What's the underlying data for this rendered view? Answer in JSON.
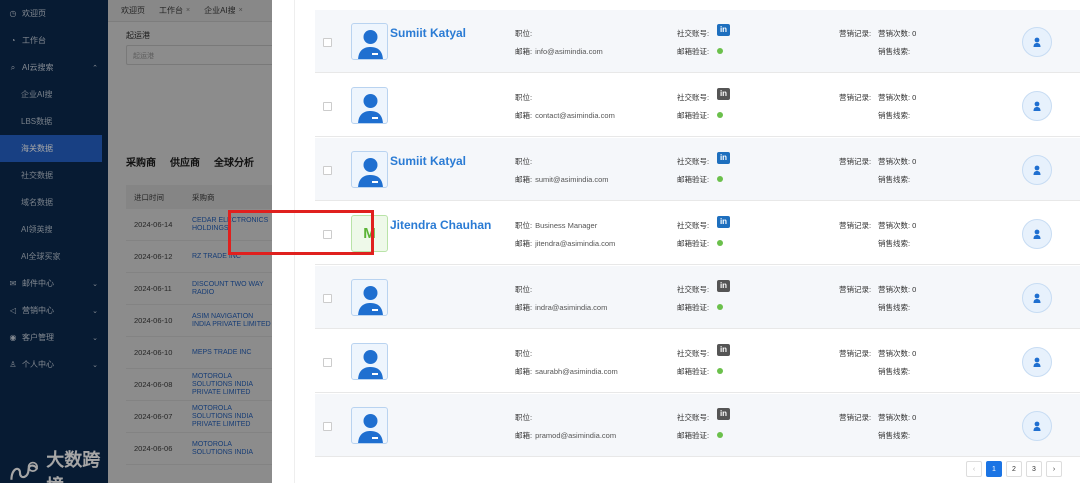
{
  "sidebar": {
    "items": [
      {
        "label": "欢迎页",
        "icon": "home-icon"
      },
      {
        "label": "工作台",
        "icon": "clock-icon"
      },
      {
        "label": "AI云搜索",
        "icon": "search-icon"
      },
      {
        "label": "企业AI搜"
      },
      {
        "label": "LBS数据"
      },
      {
        "label": "海关数据"
      },
      {
        "label": "社交数据"
      },
      {
        "label": "域名数据"
      },
      {
        "label": "AI领英搜"
      },
      {
        "label": "AI全球买家"
      },
      {
        "label": "邮件中心",
        "icon": "mail-icon"
      },
      {
        "label": "营销中心",
        "icon": "megaphone-icon"
      },
      {
        "label": "客户管理",
        "icon": "users-icon"
      },
      {
        "label": "个人中心",
        "icon": "person-icon"
      }
    ],
    "brand": "大数跨境"
  },
  "middle": {
    "tabs": [
      {
        "label": "欢迎页"
      },
      {
        "label": "工作台",
        "close": "×"
      },
      {
        "label": "企业AI搜",
        "close": "×"
      }
    ],
    "field_label": "起运港",
    "field_placeholder": "起运港",
    "nav": [
      "采购商",
      "供应商",
      "全球分析"
    ],
    "table_headers": [
      "进口时间",
      "采购商"
    ],
    "rows": [
      {
        "date": "2024-06-14",
        "company": "CEDAR ELECTRONICS HOLDINGS"
      },
      {
        "date": "2024-06-12",
        "company": "RZ TRADE INC"
      },
      {
        "date": "2024-06-11",
        "company": "DISCOUNT TWO WAY RADIO"
      },
      {
        "date": "2024-06-10",
        "company": "ASIM NAVIGATION INDIA PRIVATE LIMITED"
      },
      {
        "date": "2024-06-10",
        "company": "MEPS TRADE INC"
      },
      {
        "date": "2024-06-08",
        "company": "MOTOROLA SOLUTIONS INDIA PRIVATE LIMITED"
      },
      {
        "date": "2024-06-07",
        "company": "MOTOROLA SOLUTIONS INDIA PRIVATE LIMITED"
      },
      {
        "date": "2024-06-06",
        "company": "MOTOROLA SOLUTIONS INDIA"
      }
    ]
  },
  "labels": {
    "position": "职位:",
    "email": "邮箱:",
    "social": "社交账号:",
    "email_verify": "邮箱验证:",
    "marketing_record": "营销记录:",
    "marketing_count": "营销次数: 0",
    "sales_lead": "销售线索:",
    "linkedin": "in"
  },
  "contacts": [
    {
      "name": "Sumiit Katyal",
      "avatar": "person",
      "position": "",
      "email": "info@asimindia.com",
      "li": "blue"
    },
    {
      "name": "",
      "avatar": "person",
      "position": "",
      "email": "contact@asimindia.com",
      "li": "gray"
    },
    {
      "name": "Sumiit Katyal",
      "avatar": "person",
      "position": "",
      "email": "sumit@asimindia.com",
      "li": "blue"
    },
    {
      "name": "Jitendra Chauhan",
      "avatar": "M",
      "position": "Business Manager",
      "email": "jitendra@asimindia.com",
      "li": "blue"
    },
    {
      "name": "",
      "avatar": "person",
      "position": "",
      "email": "indra@asimindia.com",
      "li": "gray"
    },
    {
      "name": "",
      "avatar": "person",
      "position": "",
      "email": "saurabh@asimindia.com",
      "li": "gray"
    },
    {
      "name": "",
      "avatar": "person",
      "position": "",
      "email": "pramod@asimindia.com",
      "li": "gray"
    }
  ],
  "pagination": {
    "prev": "‹",
    "pages": [
      "1",
      "2",
      "3"
    ],
    "next": "›",
    "current": "1"
  },
  "colors": {
    "accent": "#1b74e4",
    "sidebar": "#0c2a4f",
    "highlight": "#e0201e",
    "verified": "#6bc04b"
  }
}
